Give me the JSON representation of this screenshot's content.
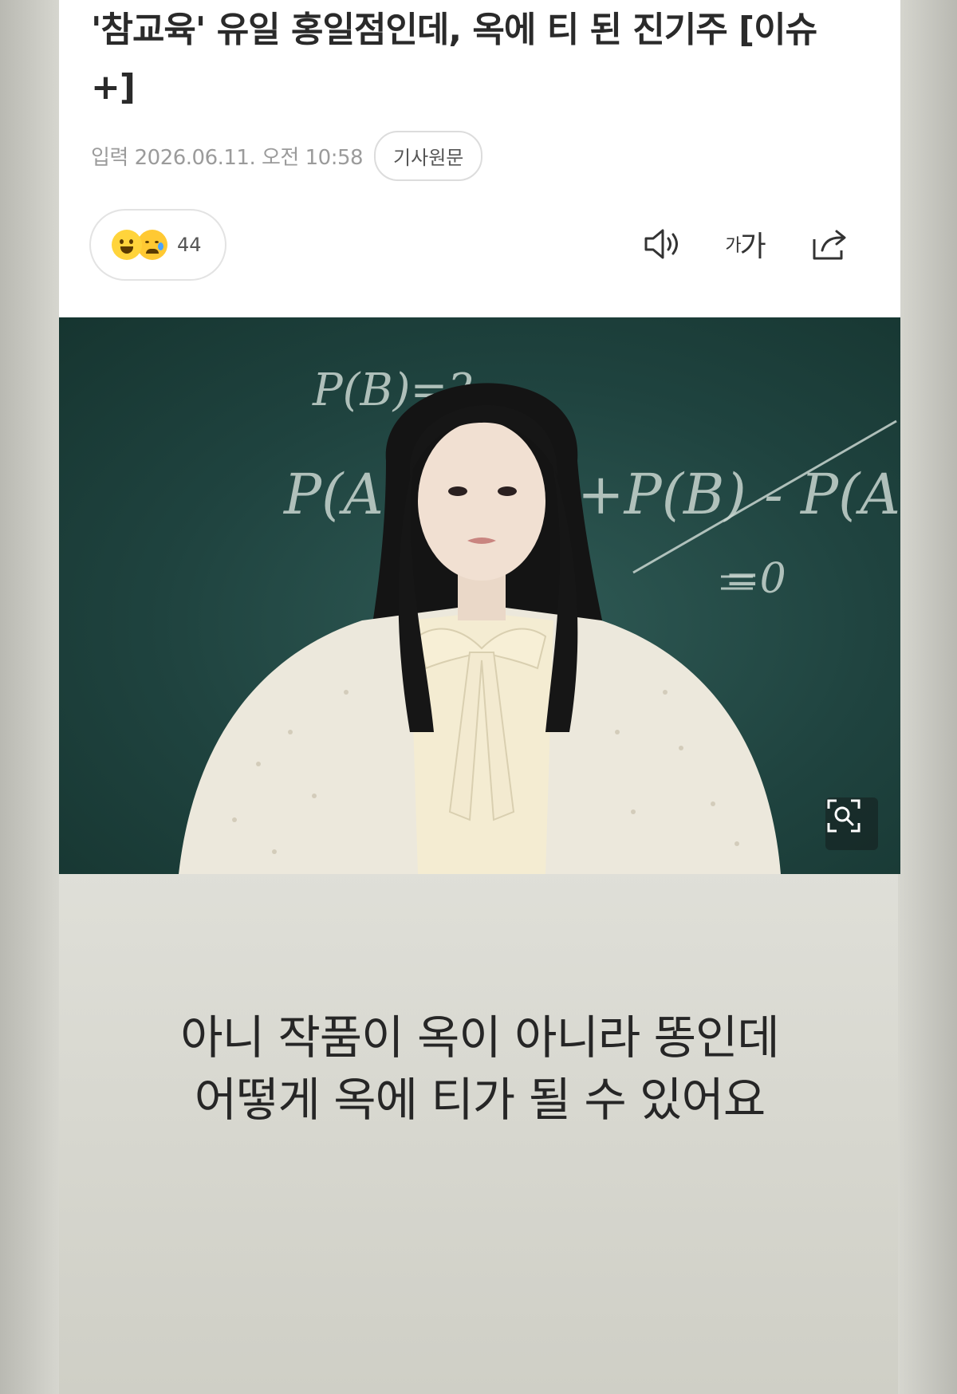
{
  "article": {
    "headline": "'참교육' 유일 홍일점인데, 옥에 티 된 진기주 [이슈+]",
    "date": "입력 2026.06.11. 오전 10:58",
    "source_button": "기사원문",
    "reactions": {
      "count": "44",
      "emoji": [
        "smile-emoji-icon",
        "crying-emoji-icon"
      ]
    },
    "tools": {
      "audio_icon": "speaker-icon",
      "font_size_label_small": "가",
      "font_size_label_large": "가",
      "share_icon": "share-icon"
    }
  },
  "photo": {
    "chalkboard_text": [
      "P(B)=?",
      "P(AU",
      "+P(B) - P(A∩B)",
      "=0"
    ],
    "zoom_icon": "zoom-search-icon"
  },
  "caption": {
    "line1": "아니 작품이 옥이 아니라 똥인데",
    "line2": "어떻게 옥에 티가 될 수 있어요"
  }
}
